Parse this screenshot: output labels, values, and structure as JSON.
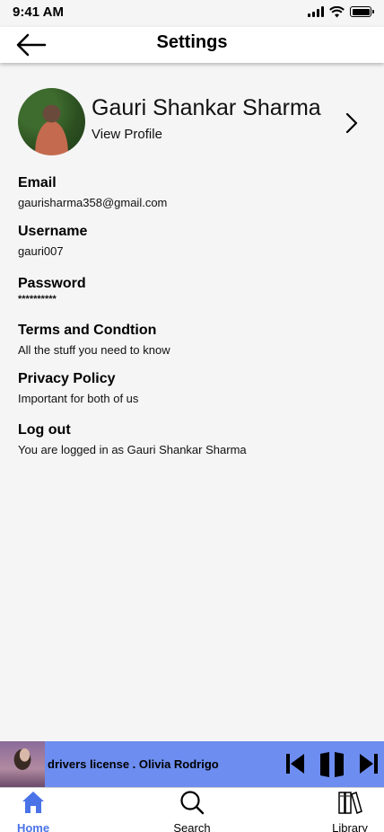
{
  "status": {
    "time": "9:41 AM"
  },
  "header": {
    "title": "Settings"
  },
  "profile": {
    "name": "Gauri Shankar Sharma",
    "subtitle": "View Profile"
  },
  "settings": [
    {
      "title": "Email",
      "subtitle": "gaurisharma358@gmail.com"
    },
    {
      "title": "Username",
      "subtitle": "gauri007"
    },
    {
      "title": "Password",
      "subtitle": "**********"
    },
    {
      "title": "Terms and Condtion",
      "subtitle": "All the stuff you need to know"
    },
    {
      "title": "Privacy Policy",
      "subtitle": "Important for both of us"
    },
    {
      "title": "Log out",
      "subtitle": "You are logged in as Gauri Shankar Sharma"
    }
  ],
  "player": {
    "track": "drivers license . Olivia Rodrigo"
  },
  "tabs": [
    {
      "label": "Home",
      "icon": "home-icon",
      "active": true
    },
    {
      "label": "Search",
      "icon": "search-icon",
      "active": false
    },
    {
      "label": "Library",
      "icon": "library-icon",
      "active": false
    }
  ],
  "colors": {
    "accent": "#4a73e8",
    "player_bg": "#6d8df0",
    "background": "#f5f5f5"
  }
}
